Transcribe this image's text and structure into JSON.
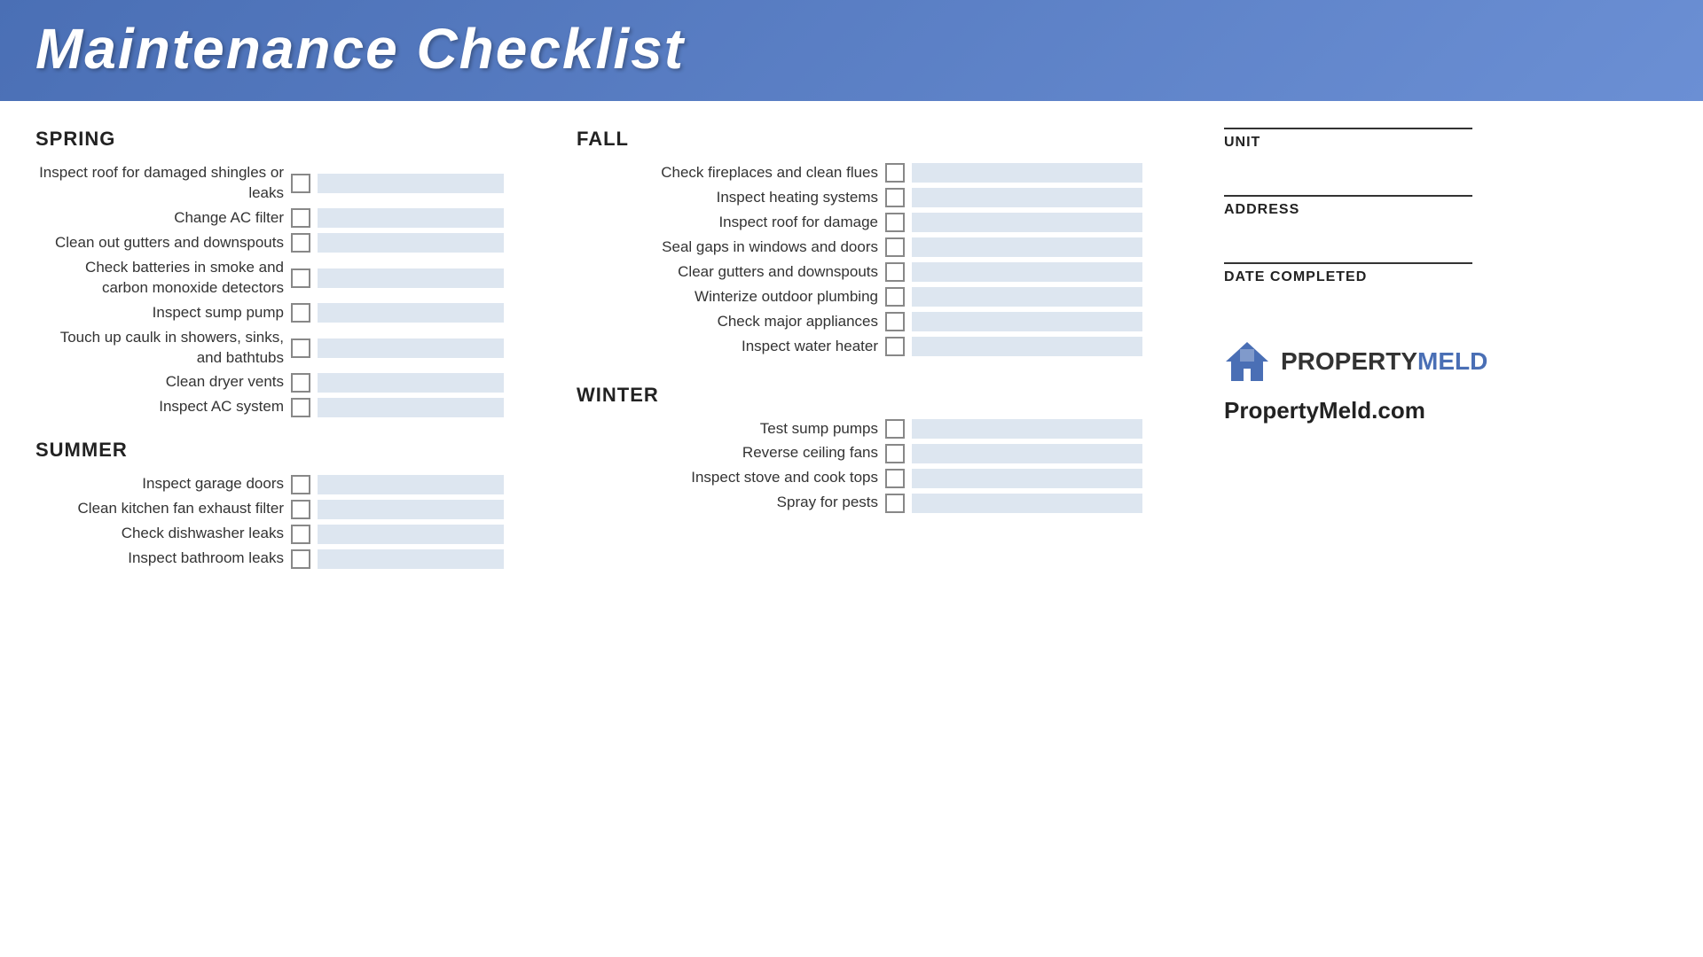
{
  "header": {
    "title": "Maintenance Checklist"
  },
  "spring": {
    "label": "SPRING",
    "items": [
      {
        "text": "Inspect roof for damaged shingles or leaks"
      },
      {
        "text": "Change AC filter"
      },
      {
        "text": "Clean out gutters and downspouts"
      },
      {
        "text": "Check batteries in smoke and carbon monoxide detectors"
      },
      {
        "text": "Inspect sump pump"
      },
      {
        "text": "Touch up caulk in showers, sinks, and bathtubs"
      },
      {
        "text": "Clean dryer vents"
      },
      {
        "text": "Inspect AC system"
      }
    ]
  },
  "summer": {
    "label": "SUMMER",
    "items": [
      {
        "text": "Inspect garage doors"
      },
      {
        "text": "Clean kitchen fan exhaust filter"
      },
      {
        "text": "Check dishwasher leaks"
      },
      {
        "text": "Inspect bathroom leaks"
      }
    ]
  },
  "fall": {
    "label": "FALL",
    "items": [
      {
        "text": "Check fireplaces and clean flues"
      },
      {
        "text": "Inspect heating systems"
      },
      {
        "text": "Inspect roof for damage"
      },
      {
        "text": "Seal gaps in windows and doors"
      },
      {
        "text": "Clear gutters and downspouts"
      },
      {
        "text": "Winterize outdoor plumbing"
      },
      {
        "text": "Check major appliances"
      },
      {
        "text": "Inspect water heater"
      }
    ]
  },
  "winter": {
    "label": "WINTER",
    "items": [
      {
        "text": "Test sump pumps"
      },
      {
        "text": "Reverse ceiling fans"
      },
      {
        "text": "Inspect stove and cook tops"
      },
      {
        "text": "Spray for pests"
      }
    ]
  },
  "fields": {
    "unit_label": "UNIT",
    "address_label": "ADDRESS",
    "date_label": "DATE COMPLETED"
  },
  "logo": {
    "property": "PROPERTY",
    "meld": "MELD",
    "website": "PropertyMeld.com"
  }
}
